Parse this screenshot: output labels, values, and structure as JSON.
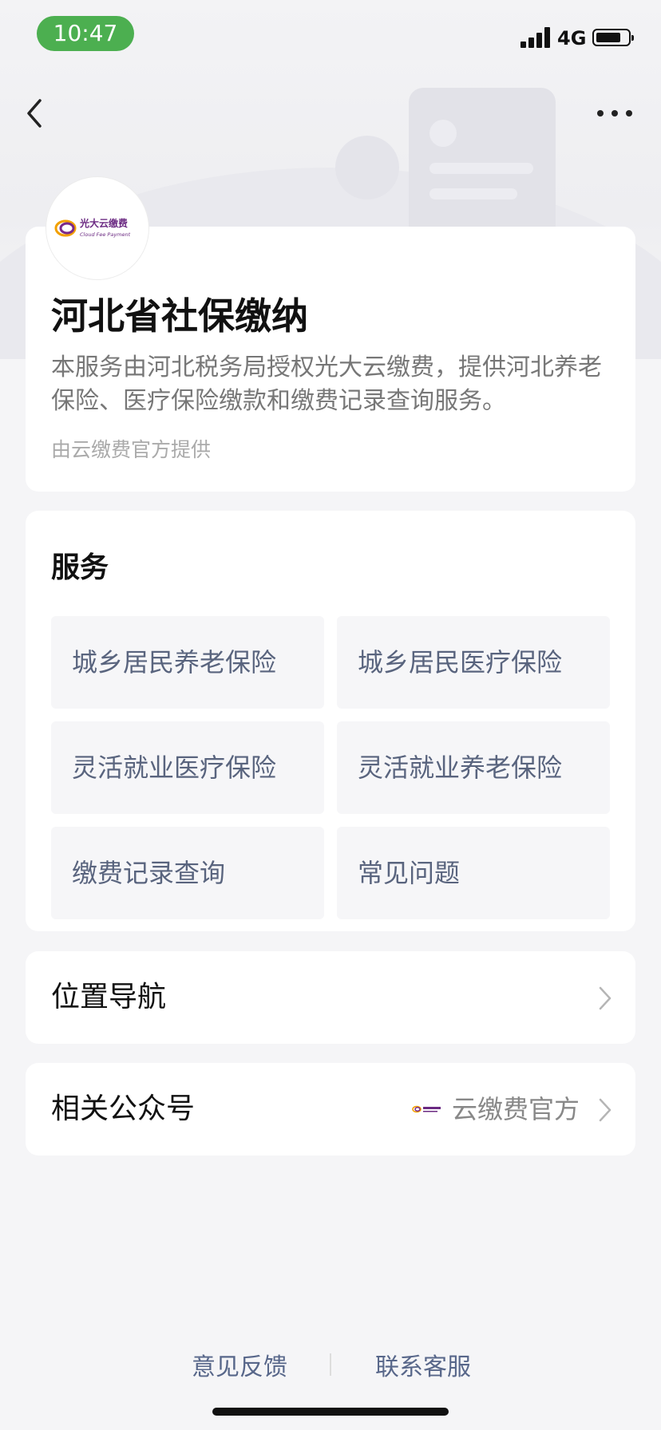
{
  "status_bar": {
    "time": "10:47",
    "network": "4G"
  },
  "header": {
    "title": "河北省社保缴纳",
    "description": "本服务由河北税务局授权光大云缴费，提供河北养老保险、医疗保险缴款和缴费记录查询服务。",
    "provider": "由云缴费官方提供",
    "logo_text": "光大云缴费",
    "logo_subtext": "Cloud Fee Payment"
  },
  "services": {
    "title": "服务",
    "items": [
      {
        "label": "城乡居民养老保险"
      },
      {
        "label": "城乡居民医疗保险"
      },
      {
        "label": "灵活就业医疗保险"
      },
      {
        "label": "灵活就业养老保险"
      },
      {
        "label": "缴费记录查询"
      },
      {
        "label": "常见问题"
      }
    ]
  },
  "navigation": {
    "label": "位置导航"
  },
  "official_account": {
    "label": "相关公众号",
    "name": "云缴费官方"
  },
  "footer": {
    "feedback": "意见反馈",
    "contact": "联系客服"
  },
  "colors": {
    "status_pill": "#4caf50",
    "service_text": "#59647e",
    "brand_purple": "#6b2a82"
  }
}
